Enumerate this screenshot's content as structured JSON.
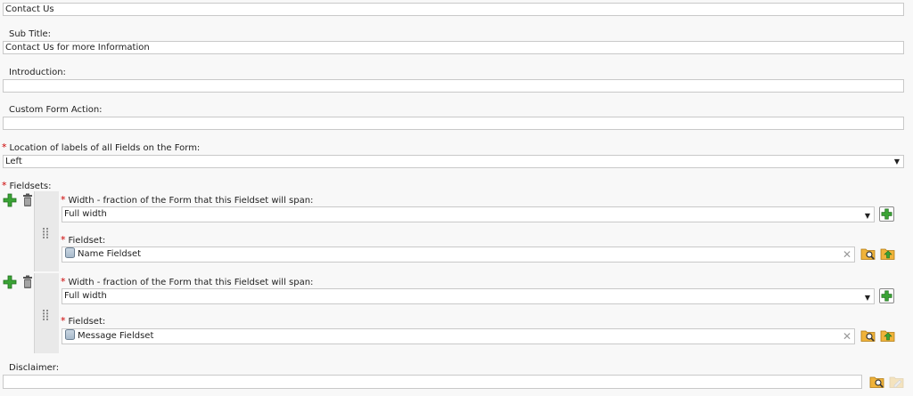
{
  "form": {
    "title_value": "Contact Us",
    "subtitle_label": "Sub Title:",
    "subtitle_value": "Contact Us for more Information",
    "introduction_label": "Introduction:",
    "introduction_value": "",
    "custom_action_label": "Custom Form Action:",
    "custom_action_value": "",
    "labels_location_label": "Location of labels of all Fields on the Form:",
    "labels_location_value": "Left",
    "fieldsets_label": "Fieldsets:",
    "disclaimer_label": "Disclaimer:",
    "disclaimer_value": ""
  },
  "fieldsets": [
    {
      "width_label": "Width - fraction of the Form that this Fieldset will span:",
      "width_value": "Full width",
      "fieldset_label": "Fieldset:",
      "fieldset_value": "Name Fieldset"
    },
    {
      "width_label": "Width - fraction of the Form that this Fieldset will span:",
      "width_value": "Full width",
      "fieldset_label": "Fieldset:",
      "fieldset_value": "Message Fieldset"
    }
  ],
  "colors": {
    "required_marker": "#cc0000",
    "add_green": "#3aa335",
    "folder_orange": "#f0b33a"
  },
  "icons": {
    "required": "*",
    "clear": "✕",
    "dropdown": "▼",
    "grip": "⠿"
  }
}
